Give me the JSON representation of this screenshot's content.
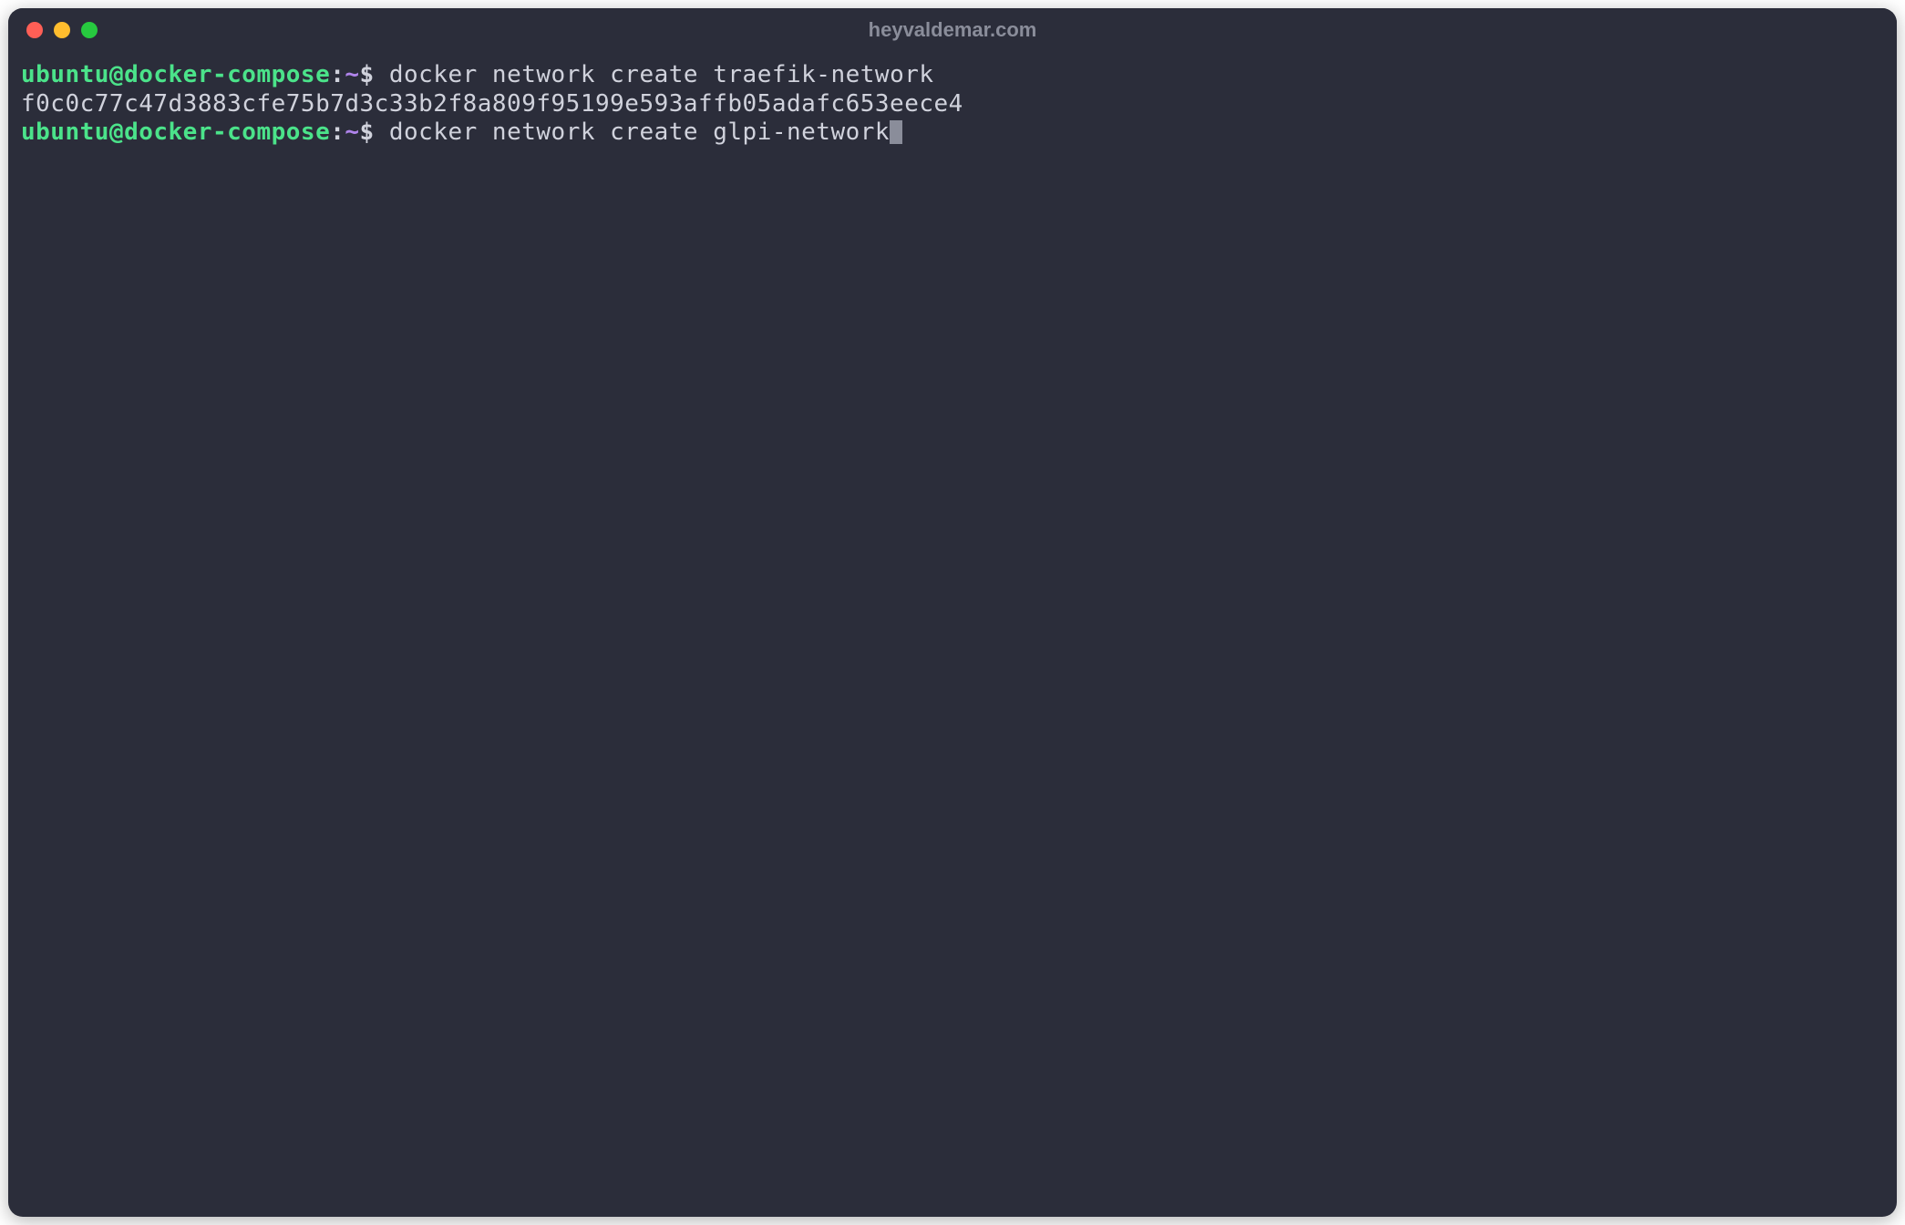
{
  "window": {
    "title": "heyvaldemar.com"
  },
  "terminal": {
    "lines": [
      {
        "user_host": "ubuntu@docker-compose",
        "colon": ":",
        "path": "~",
        "dollar": "$",
        "command": " docker network create traefik-network"
      },
      {
        "output": "f0c0c77c47d3883cfe75b7d3c33b2f8a809f95199e593affb05adafc653eece4"
      },
      {
        "user_host": "ubuntu@docker-compose",
        "colon": ":",
        "path": "~",
        "dollar": "$",
        "command": " docker network create glpi-network"
      }
    ]
  }
}
